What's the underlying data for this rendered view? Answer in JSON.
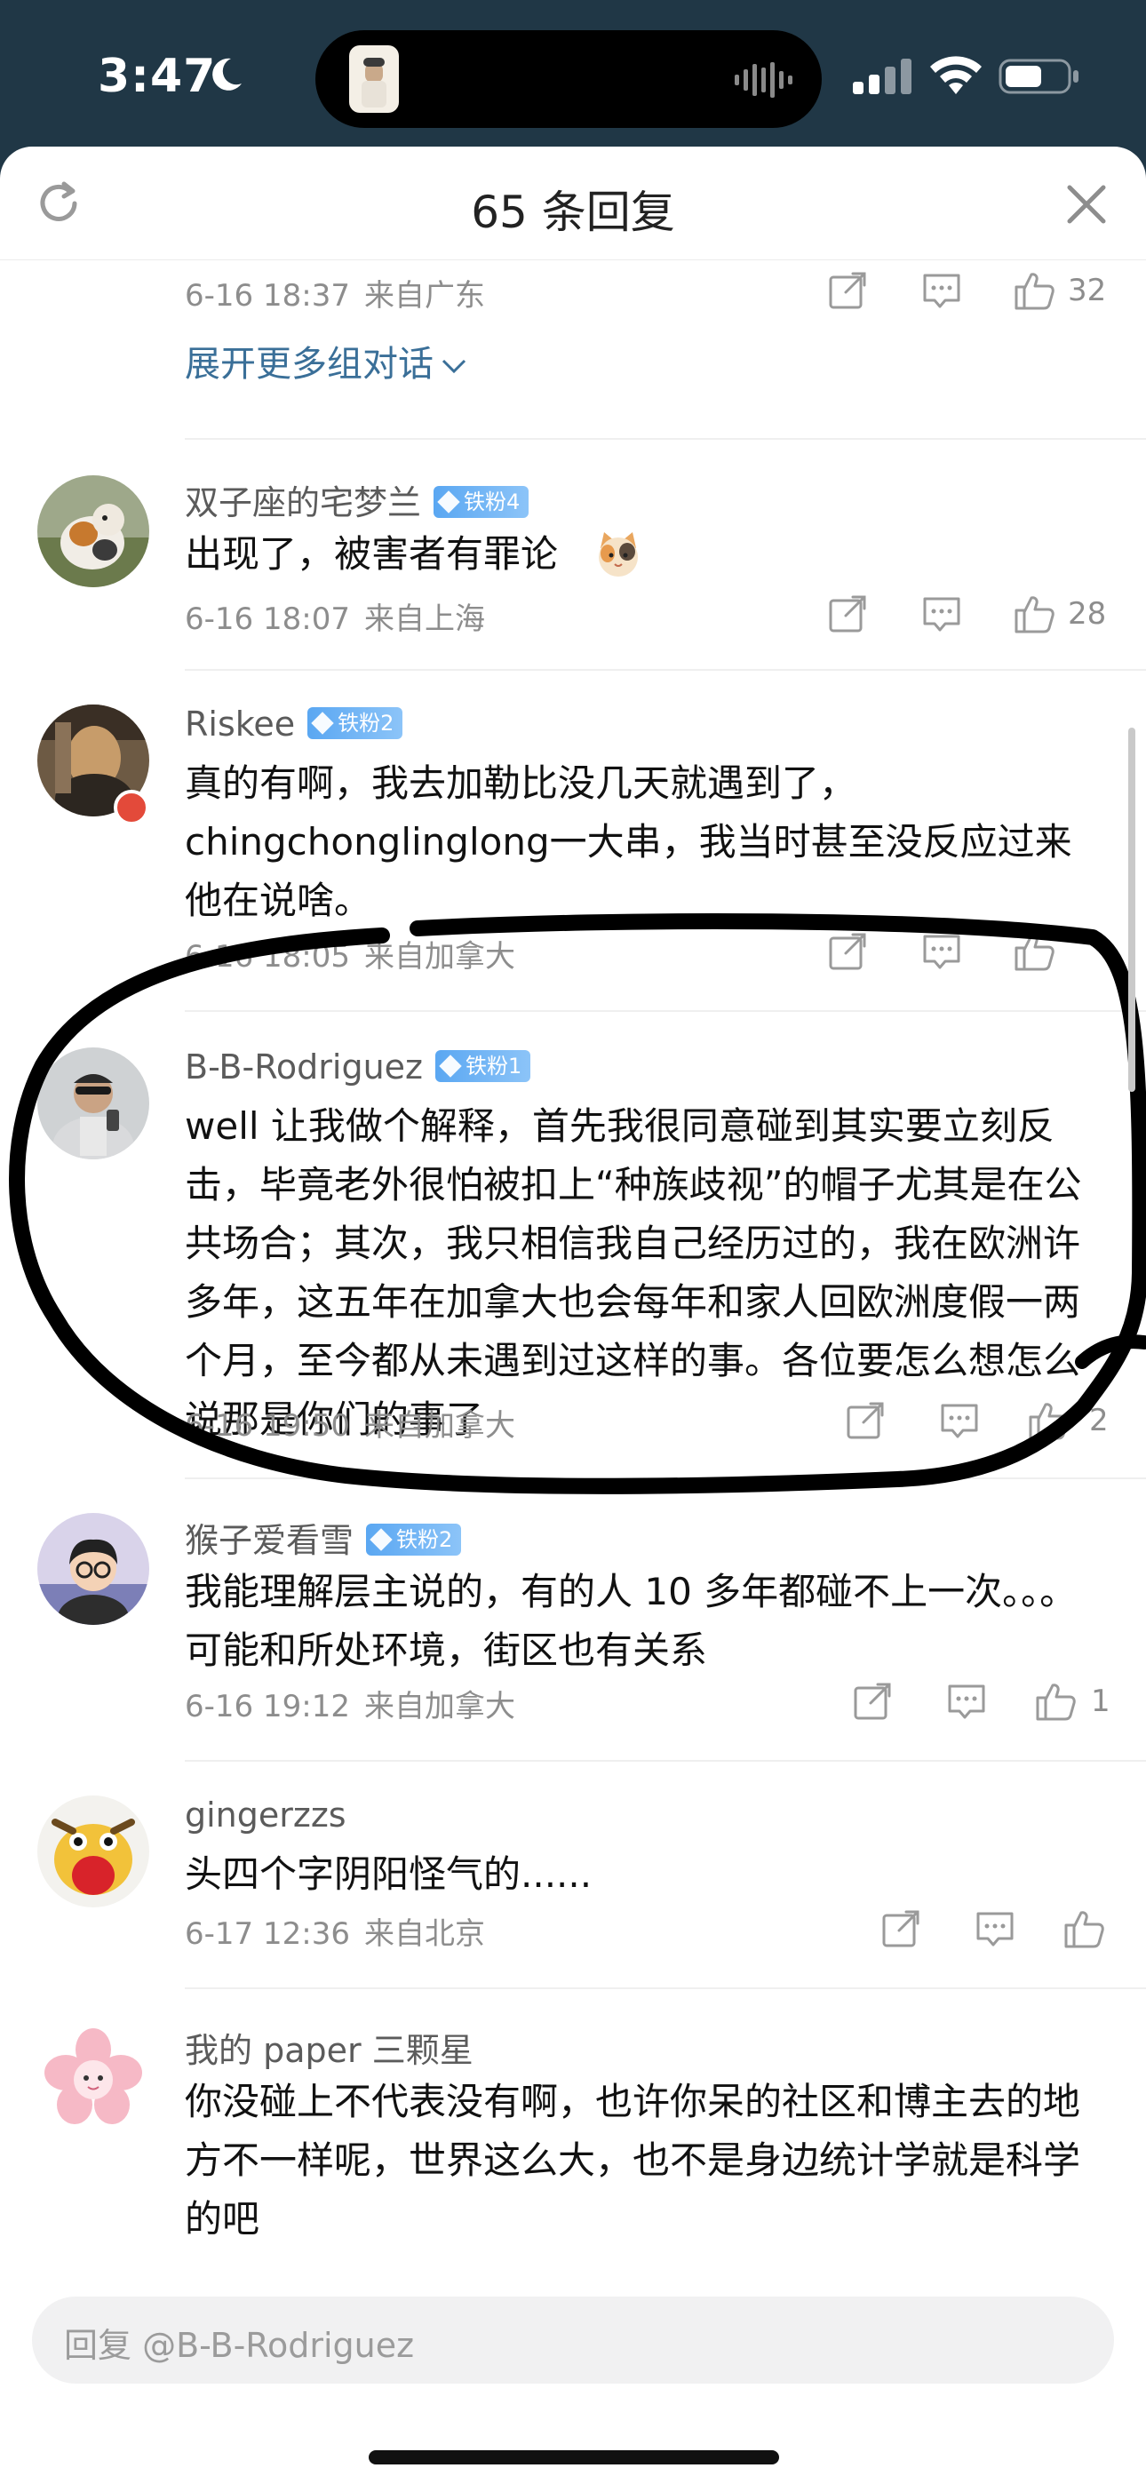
{
  "status_bar": {
    "time": "3:47"
  },
  "header": {
    "title": "65 条回复"
  },
  "top_item": {
    "date": "6-16 18:37",
    "location": "来自广东",
    "likes": "32",
    "expand_label": "展开更多组对话"
  },
  "comments": [
    {
      "username": "双子座的宅梦兰",
      "badge": "铁粉4",
      "text": "出现了，被害者有罪论",
      "date": "6-16 18:07",
      "location": "来自上海",
      "likes": "28"
    },
    {
      "username": "Riskee",
      "badge": "铁粉2",
      "text": "真的有啊，我去加勒比没几天就遇到了，chingchonglinglong一大串，我当时甚至没反应过来他在说啥。",
      "date": "6-16 18:05",
      "location": "来自加拿大",
      "likes": ""
    },
    {
      "username": "B-B-Rodriguez",
      "badge": "铁粉1",
      "text": "well 让我做个解释，首先我很同意碰到其实要立刻反击，毕竟老外很怕被扣上“种族歧视”的帽子尤其是在公共场合；其次，我只相信我自己经历过的，我在欧洲许多年，这五年在加拿大也会每年和家人回欧洲度假一两个月，至今都从未遇到过这样的事。各位要怎么想怎么说那是你们的事了",
      "date": "6-16 19:50",
      "location": "来自加拿大",
      "likes": "2"
    },
    {
      "username": "猴子爱看雪",
      "badge": "铁粉2",
      "text": "我能理解层主说的，有的人 10 多年都碰不上一次。。。可能和所处环境，街区也有关系",
      "date": "6-16 19:12",
      "location": "来自加拿大",
      "likes": "1"
    },
    {
      "username": "gingerzzs",
      "badge": "",
      "text": "头四个字阴阳怪气的......",
      "date": "6-17 12:36",
      "location": "来自北京",
      "likes": ""
    },
    {
      "username": "我的 paper 三颗星",
      "badge": "",
      "text": "你没碰上不代表没有啊，也许你呆的社区和博主去的地方不一样呢，世界这么大，也不是身边统计学就是科学的吧",
      "date": "",
      "location": "",
      "likes": ""
    }
  ],
  "reply_bar": {
    "placeholder": "回复 @B-B-Rodriguez"
  },
  "colors": {
    "link": "#3a6f98",
    "badge": "#5aa7f2",
    "status_bg": "#203746"
  }
}
